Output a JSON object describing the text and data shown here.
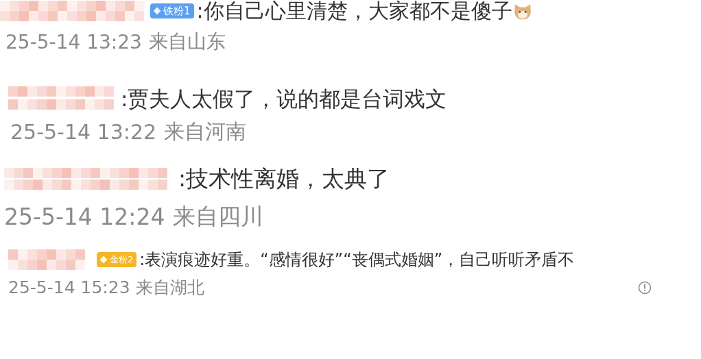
{
  "comments": [
    {
      "badge": {
        "label": "铁粉1",
        "color": "#5b9ff0"
      },
      "text": ":你自己心里清楚，大家都不是傻子",
      "emoji": true,
      "date": "25-5-14 13:23",
      "location": "来自山东",
      "info": false
    },
    {
      "text": ":贾夫人太假了，说的都是台词戏文",
      "emoji": false,
      "date": "25-5-14 13:22",
      "location": "来自河南",
      "info": false
    },
    {
      "text": ":技术性离婚，太典了",
      "emoji": false,
      "date": "25-5-14 12:24",
      "location": "来自四川",
      "info": false
    },
    {
      "badge": {
        "label": "金粉2",
        "color": "#f5b526"
      },
      "text": ":表演痕迹好重。“感情很好”“丧偶式婚姻”，自己听听矛盾不",
      "emoji": false,
      "date": "25-5-14 15:23",
      "location": "来自湖北",
      "info": true
    }
  ]
}
